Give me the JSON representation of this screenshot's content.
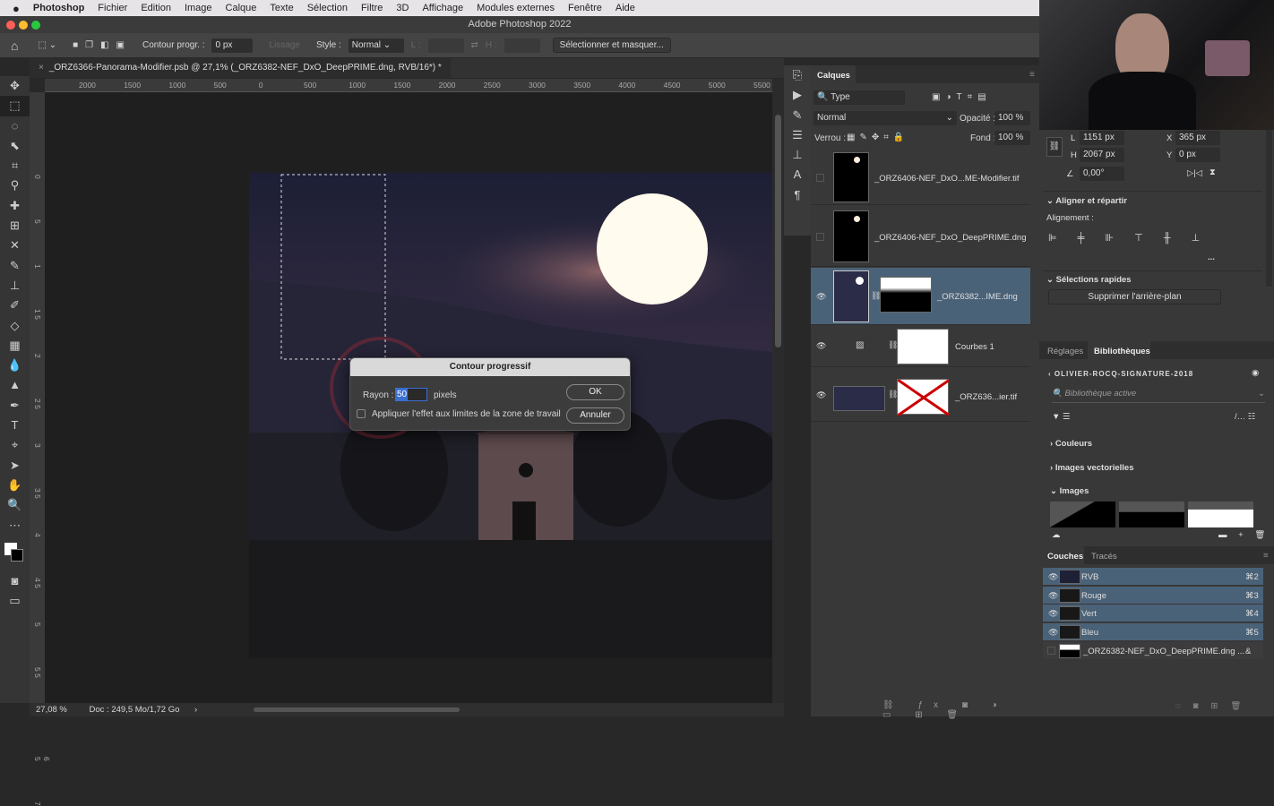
{
  "menu": {
    "apple": "",
    "app": "Photoshop",
    "items": [
      "Fichier",
      "Edition",
      "Image",
      "Calque",
      "Texte",
      "Sélection",
      "Filtre",
      "3D",
      "Affichage",
      "Modules externes",
      "Fenêtre",
      "Aide"
    ]
  },
  "window": {
    "title": "Adobe Photoshop 2022"
  },
  "options": {
    "feather_label": "Contour progr. :",
    "feather_value": "0 px",
    "smooth_label": "Lissage",
    "style_label": "Style :",
    "style_value": "Normal",
    "width_label": "L :",
    "height_label": "H :",
    "select_mask": "Sélectionner et masquer..."
  },
  "document": {
    "tab": "_ORZ6366-Panorama-Modifier.psb @ 27,1% (_ORZ6382-NEF_DxO_DeepPRIME.dng, RVB/16*) *",
    "zoom": "27,08 %",
    "doc_info": "Doc : 249,5 Mo/1,72 Go"
  },
  "rulers": {
    "h": [
      "2000",
      "1500",
      "1000",
      "500",
      "0",
      "500",
      "1000",
      "1500",
      "2000",
      "2500",
      "3000",
      "3500",
      "4000",
      "4500",
      "5000",
      "5500"
    ],
    "v": [
      "0",
      "5",
      "1",
      "1 5",
      "2",
      "2 5",
      "3",
      "3 5",
      "4",
      "4 5",
      "5",
      "5 5",
      "6",
      "6 5",
      "7"
    ]
  },
  "dialog": {
    "title": "Contour progressif",
    "radius_label": "Rayon :",
    "radius_value": "50",
    "unit": "pixels",
    "checkbox_label": "Appliquer l'effet aux limites de la zone de travail",
    "checkbox_checked": false,
    "ok": "OK",
    "cancel": "Annuler"
  },
  "layers_panel": {
    "tab": "Calques",
    "filter": "Type",
    "blend": "Normal",
    "opacity_label": "Opacité :",
    "opacity": "100 %",
    "lock_label": "Verrou :",
    "fill_label": "Fond :",
    "fill": "100 %",
    "layers": [
      {
        "name": "_ORZ6406-NEF_DxO...ME-Modifier.tif",
        "visible": false
      },
      {
        "name": "_ORZ6406-NEF_DxO_DeepPRIME.dng",
        "visible": false
      },
      {
        "name": "_ORZ6382...IME.dng",
        "visible": true,
        "selected": true
      },
      {
        "name": "Courbes 1",
        "visible": true
      },
      {
        "name": "_ORZ636...ier.tif",
        "visible": true
      }
    ]
  },
  "properties": {
    "w_label": "L",
    "w": "1151 px",
    "h_label": "H",
    "h": "2067 px",
    "x_label": "X",
    "x": "365 px",
    "y_label": "Y",
    "y": "0 px",
    "angle": "0,00°",
    "align_title": "Aligner et répartir",
    "align_label": "Alignement :",
    "more": "...",
    "quick_title": "Sélections rapides",
    "remove_bg": "Supprimer l'arrière-plan"
  },
  "libraries": {
    "tabs": [
      "Réglages",
      "Bibliothèques"
    ],
    "library": "OLIVIER-ROCQ-SIGNATURE-2018",
    "search_placeholder": "Bibliothèque active",
    "sections": [
      "Couleurs",
      "Images vectorielles",
      "Images"
    ]
  },
  "channels": {
    "tabs": [
      "Couches",
      "Tracés"
    ],
    "items": [
      {
        "name": "RVB",
        "shortcut": "⌘2"
      },
      {
        "name": "Rouge",
        "shortcut": "⌘3"
      },
      {
        "name": "Vert",
        "shortcut": "⌘4"
      },
      {
        "name": "Bleu",
        "shortcut": "⌘5"
      },
      {
        "name": "_ORZ6382-NEF_DxO_DeepPRIME.dng ...",
        "shortcut": "&"
      }
    ]
  },
  "colors": {
    "selection": "#4a6278",
    "accent": "#3b6fd1"
  }
}
